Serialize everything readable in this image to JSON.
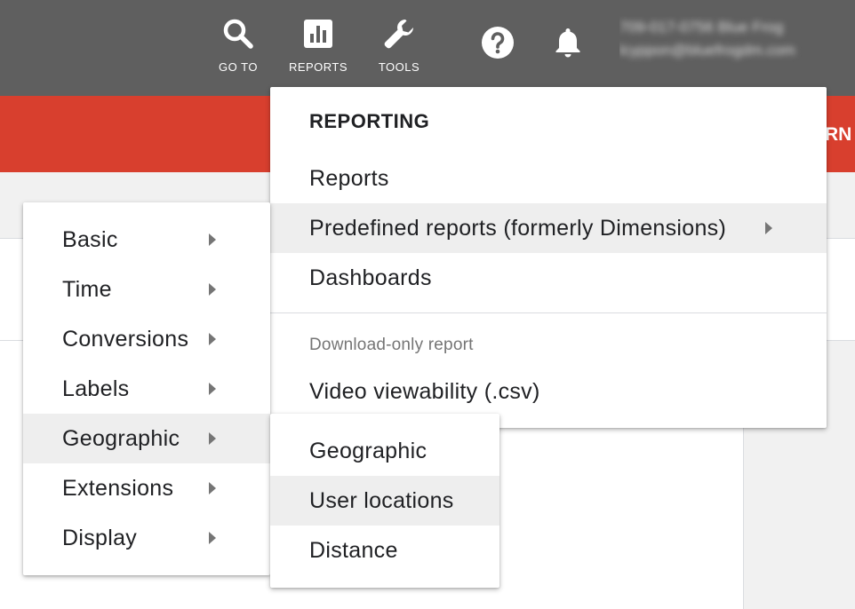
{
  "topbar": {
    "goto_label": "GO TO",
    "reports_label": "REPORTS",
    "tools_label": "TOOLS",
    "goto_icon": "search-icon",
    "reports_icon": "bar-chart-icon",
    "tools_icon": "wrench-icon",
    "help_icon": "help-icon",
    "notifications_icon": "bell-icon",
    "account_id": "709-017-0756 Blue Frog",
    "account_email": "lcyppon@bluefrogdm.com",
    "background_color": "#5f5f5f"
  },
  "banner": {
    "text": "RN",
    "color": "#d83f2e"
  },
  "reporting_menu": {
    "title": "REPORTING",
    "items": [
      {
        "label": "Reports"
      },
      {
        "label": "Predefined reports (formerly Dimensions)"
      },
      {
        "label": "Dashboards"
      }
    ],
    "download_heading": "Download-only report",
    "download_item": "Video viewability (.csv)"
  },
  "predefined_menu": {
    "items": [
      {
        "label": "Basic"
      },
      {
        "label": "Time"
      },
      {
        "label": "Conversions"
      },
      {
        "label": "Labels"
      },
      {
        "label": "Geographic"
      },
      {
        "label": "Extensions"
      },
      {
        "label": "Display"
      }
    ]
  },
  "geographic_menu": {
    "items": [
      {
        "label": "Geographic"
      },
      {
        "label": "User locations"
      },
      {
        "label": "Distance"
      }
    ]
  }
}
